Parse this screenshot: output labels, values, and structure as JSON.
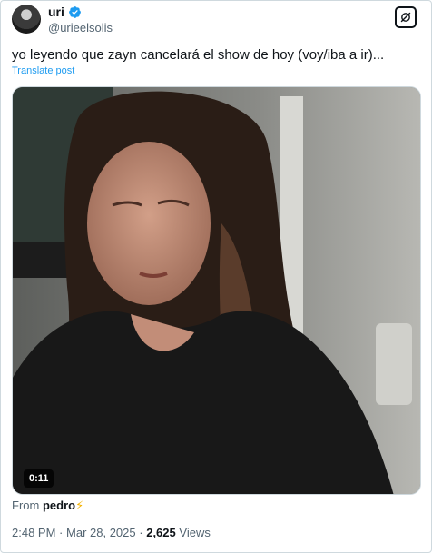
{
  "author": {
    "display_name": "uri",
    "handle": "@urieelsolis",
    "verified_color": "#1d9bf0"
  },
  "post": {
    "text": "yo leyendo que zayn cancelará el show de hoy (voy/iba a ir)...",
    "translate_label": "Translate post"
  },
  "media": {
    "duration": "0:11"
  },
  "source": {
    "prefix": "From",
    "name": "pedro",
    "emoji": "⚡"
  },
  "meta": {
    "time": "2:48 PM",
    "separator": "·",
    "date": "Mar 28, 2025",
    "views_count": "2,625",
    "views_label": "Views"
  },
  "icons": {
    "top_right": "grok-icon",
    "badge": "verified-badge-icon"
  }
}
